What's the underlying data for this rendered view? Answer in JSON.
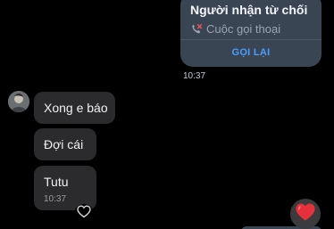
{
  "call_card": {
    "title": "Người nhận từ chối",
    "subtitle": "Cuộc gọi thoại",
    "action": "GỌI LẠI",
    "time": "10:37"
  },
  "messages": [
    {
      "text": "Xong e báo"
    },
    {
      "text": "Đợi cái"
    },
    {
      "text": "Tutu",
      "time": "10:37"
    }
  ],
  "icons": {
    "call_icon": "declined-phone-icon",
    "react": "heart-outline-icon",
    "reaction": "heart-filled-icon"
  },
  "colors": {
    "background": "#000000",
    "call_card": "#3a4553",
    "incoming_bubble": "#2b2b2d",
    "action_blue": "#4a9eff",
    "heart_red": "#e8303a"
  }
}
